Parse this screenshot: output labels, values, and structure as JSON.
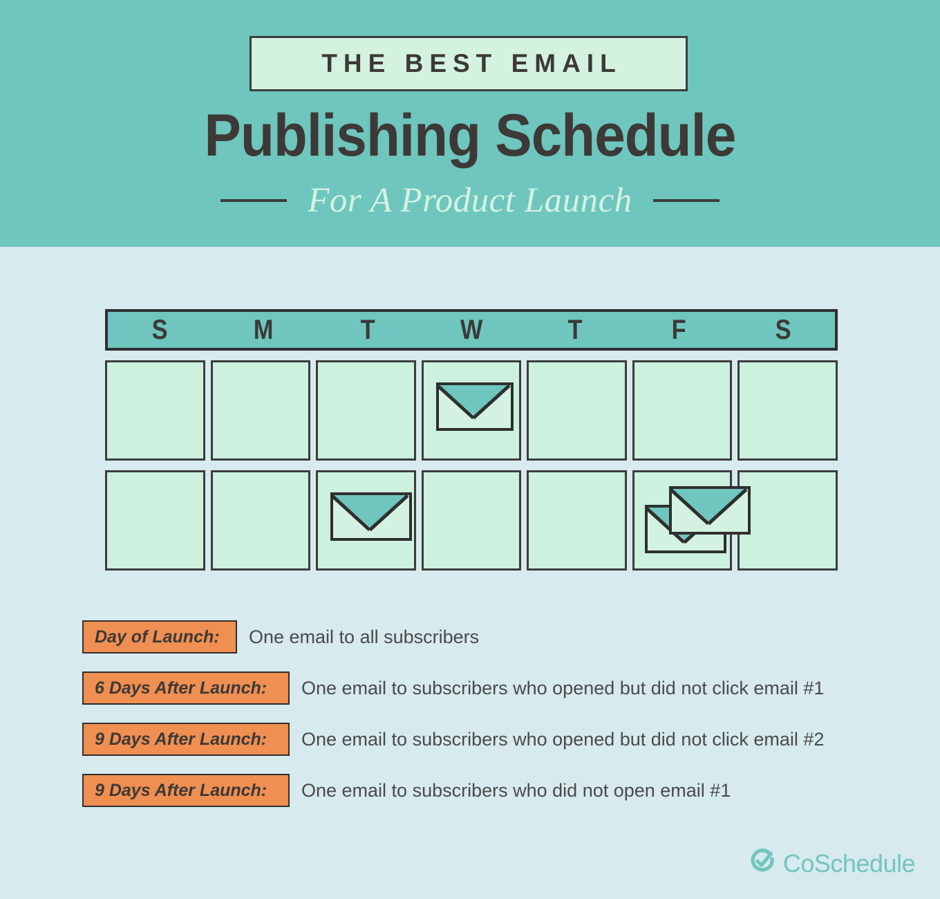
{
  "header": {
    "eyebrow": "THE BEST EMAIL",
    "title": "Publishing Schedule",
    "subtitle": "For A Product Launch",
    "band_color": "#6ec6be",
    "eyebrow_box_color": "#d4f2e0",
    "title_color": "#3c3937",
    "subtitle_color": "#d4f2e2"
  },
  "page": {
    "background_color": "#d7eaee",
    "accent_orange": "#ef8f51",
    "ink_color": "#3c3937"
  },
  "calendar": {
    "weekdays": [
      "S",
      "M",
      "T",
      "W",
      "T",
      "F",
      "S"
    ],
    "header_bar_color": "#6ec6be",
    "cell_color": "#ccf1de",
    "envelope_flap_color": "#6ec6be",
    "envelope_body_color": "#d3f2e2",
    "weeks": [
      {
        "label": "week-1",
        "days": [
          {
            "day": "S",
            "envelopes": 0
          },
          {
            "day": "M",
            "envelopes": 0
          },
          {
            "day": "T",
            "envelopes": 0
          },
          {
            "day": "W",
            "envelopes": 1
          },
          {
            "day": "T",
            "envelopes": 0
          },
          {
            "day": "F",
            "envelopes": 0
          },
          {
            "day": "S",
            "envelopes": 0
          }
        ]
      },
      {
        "label": "week-2",
        "days": [
          {
            "day": "S",
            "envelopes": 0
          },
          {
            "day": "M",
            "envelopes": 0
          },
          {
            "day": "T",
            "envelopes": 1
          },
          {
            "day": "W",
            "envelopes": 0
          },
          {
            "day": "T",
            "envelopes": 0
          },
          {
            "day": "F",
            "envelopes": 2
          },
          {
            "day": "S",
            "envelopes": 0
          }
        ]
      }
    ]
  },
  "legend": {
    "rows": [
      {
        "badge": "Day of Launch:",
        "description": "One email to all subscribers",
        "badge_width": 224
      },
      {
        "badge": "6 Days After Launch:",
        "description": "One email to subscribers who opened but did not click email #1",
        "badge_width": 300
      },
      {
        "badge": "9 Days After Launch:",
        "description": "One email to subscribers who opened but did not click email #2",
        "badge_width": 300
      },
      {
        "badge": "9 Days After Launch:",
        "description": "One email to subscribers who did not open email #1",
        "badge_width": 300
      }
    ]
  },
  "footer": {
    "brand": "CoSchedule",
    "brand_color": "#72c5be",
    "icon": "check-circle-icon"
  }
}
